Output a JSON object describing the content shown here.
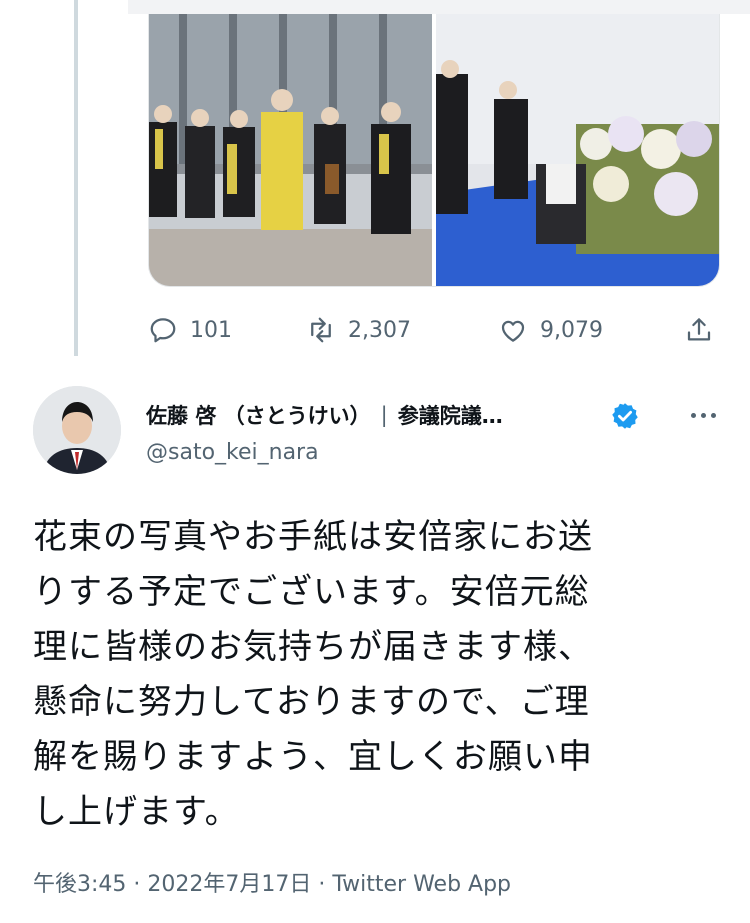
{
  "stats": {
    "reply_count": "101",
    "retweet_count": "2,307",
    "like_count": "9,079"
  },
  "author": {
    "name": "佐藤 啓 （さとうけい）",
    "title": "参議院議…",
    "handle": "@sato_kei_nara",
    "verified": true
  },
  "tweet": {
    "lines": [
      "花束の写真やお手紙は安倍家にお送",
      "りする予定でございます。安倍元総",
      "理に皆様のお気持ちが届きます様、",
      "懸命に努力しておりますので、ご理",
      "解を賜りますよう、宜しくお願い申",
      "し上げます。"
    ]
  },
  "meta": {
    "timestamp": "午後3:45 · 2022年7月17日 · Twitter Web App"
  },
  "colors": {
    "accent": "#1d9bf0",
    "secondary_text": "#536471",
    "thread_line": "#cfd9de"
  },
  "icons": [
    "reply-icon",
    "retweet-icon",
    "like-icon",
    "share-icon",
    "verified-badge-icon",
    "more-options-icon"
  ]
}
